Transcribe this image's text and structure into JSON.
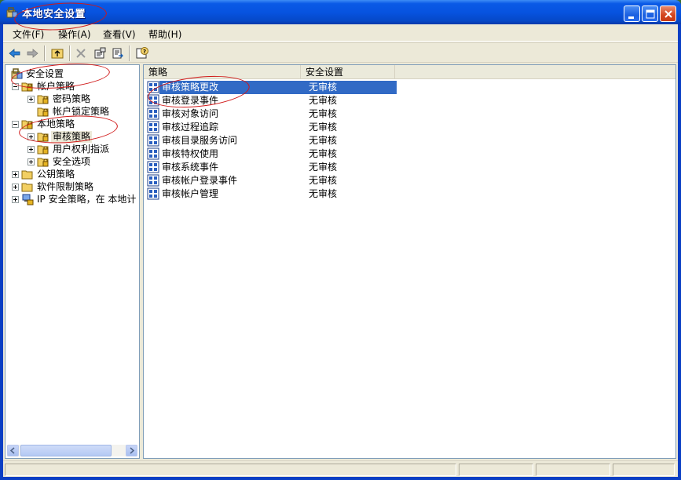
{
  "window": {
    "title": "本地安全设置"
  },
  "menu": [
    {
      "label": "文件(F)"
    },
    {
      "label": "操作(A)"
    },
    {
      "label": "查看(V)"
    },
    {
      "label": "帮助(H)"
    }
  ],
  "toolbar": {
    "icons": [
      "back-arrow-icon",
      "forward-arrow-icon",
      "up-folder-icon",
      "delete-icon",
      "properties-icon",
      "export-list-icon",
      "help-icon"
    ]
  },
  "tree": {
    "root": "安全设置",
    "account_policy": "帐户策略",
    "password_policy": "密码策略",
    "lockout_policy": "帐户锁定策略",
    "local_policy": "本地策略",
    "audit_policy": "审核策略",
    "user_rights": "用户权利指派",
    "security_options": "安全选项",
    "public_key": "公钥策略",
    "software_restriction": "软件限制策略",
    "ip_security": "IP 安全策略，在 本地计"
  },
  "list": {
    "col_policy": "策略",
    "col_setting": "安全设置",
    "rows": [
      {
        "name": "审核策略更改",
        "value": "无审核"
      },
      {
        "name": "审核登录事件",
        "value": "无审核"
      },
      {
        "name": "审核对象访问",
        "value": "无审核"
      },
      {
        "name": "审核过程追踪",
        "value": "无审核"
      },
      {
        "name": "审核目录服务访问",
        "value": "无审核"
      },
      {
        "name": "审核特权使用",
        "value": "无审核"
      },
      {
        "name": "审核系统事件",
        "value": "无审核"
      },
      {
        "name": "审核帐户登录事件",
        "value": "无审核"
      },
      {
        "name": "审核帐户管理",
        "value": "无审核"
      }
    ]
  },
  "colors": {
    "titlebar": "#0753e0",
    "selection": "#316ac5",
    "annotation": "#d01818"
  }
}
